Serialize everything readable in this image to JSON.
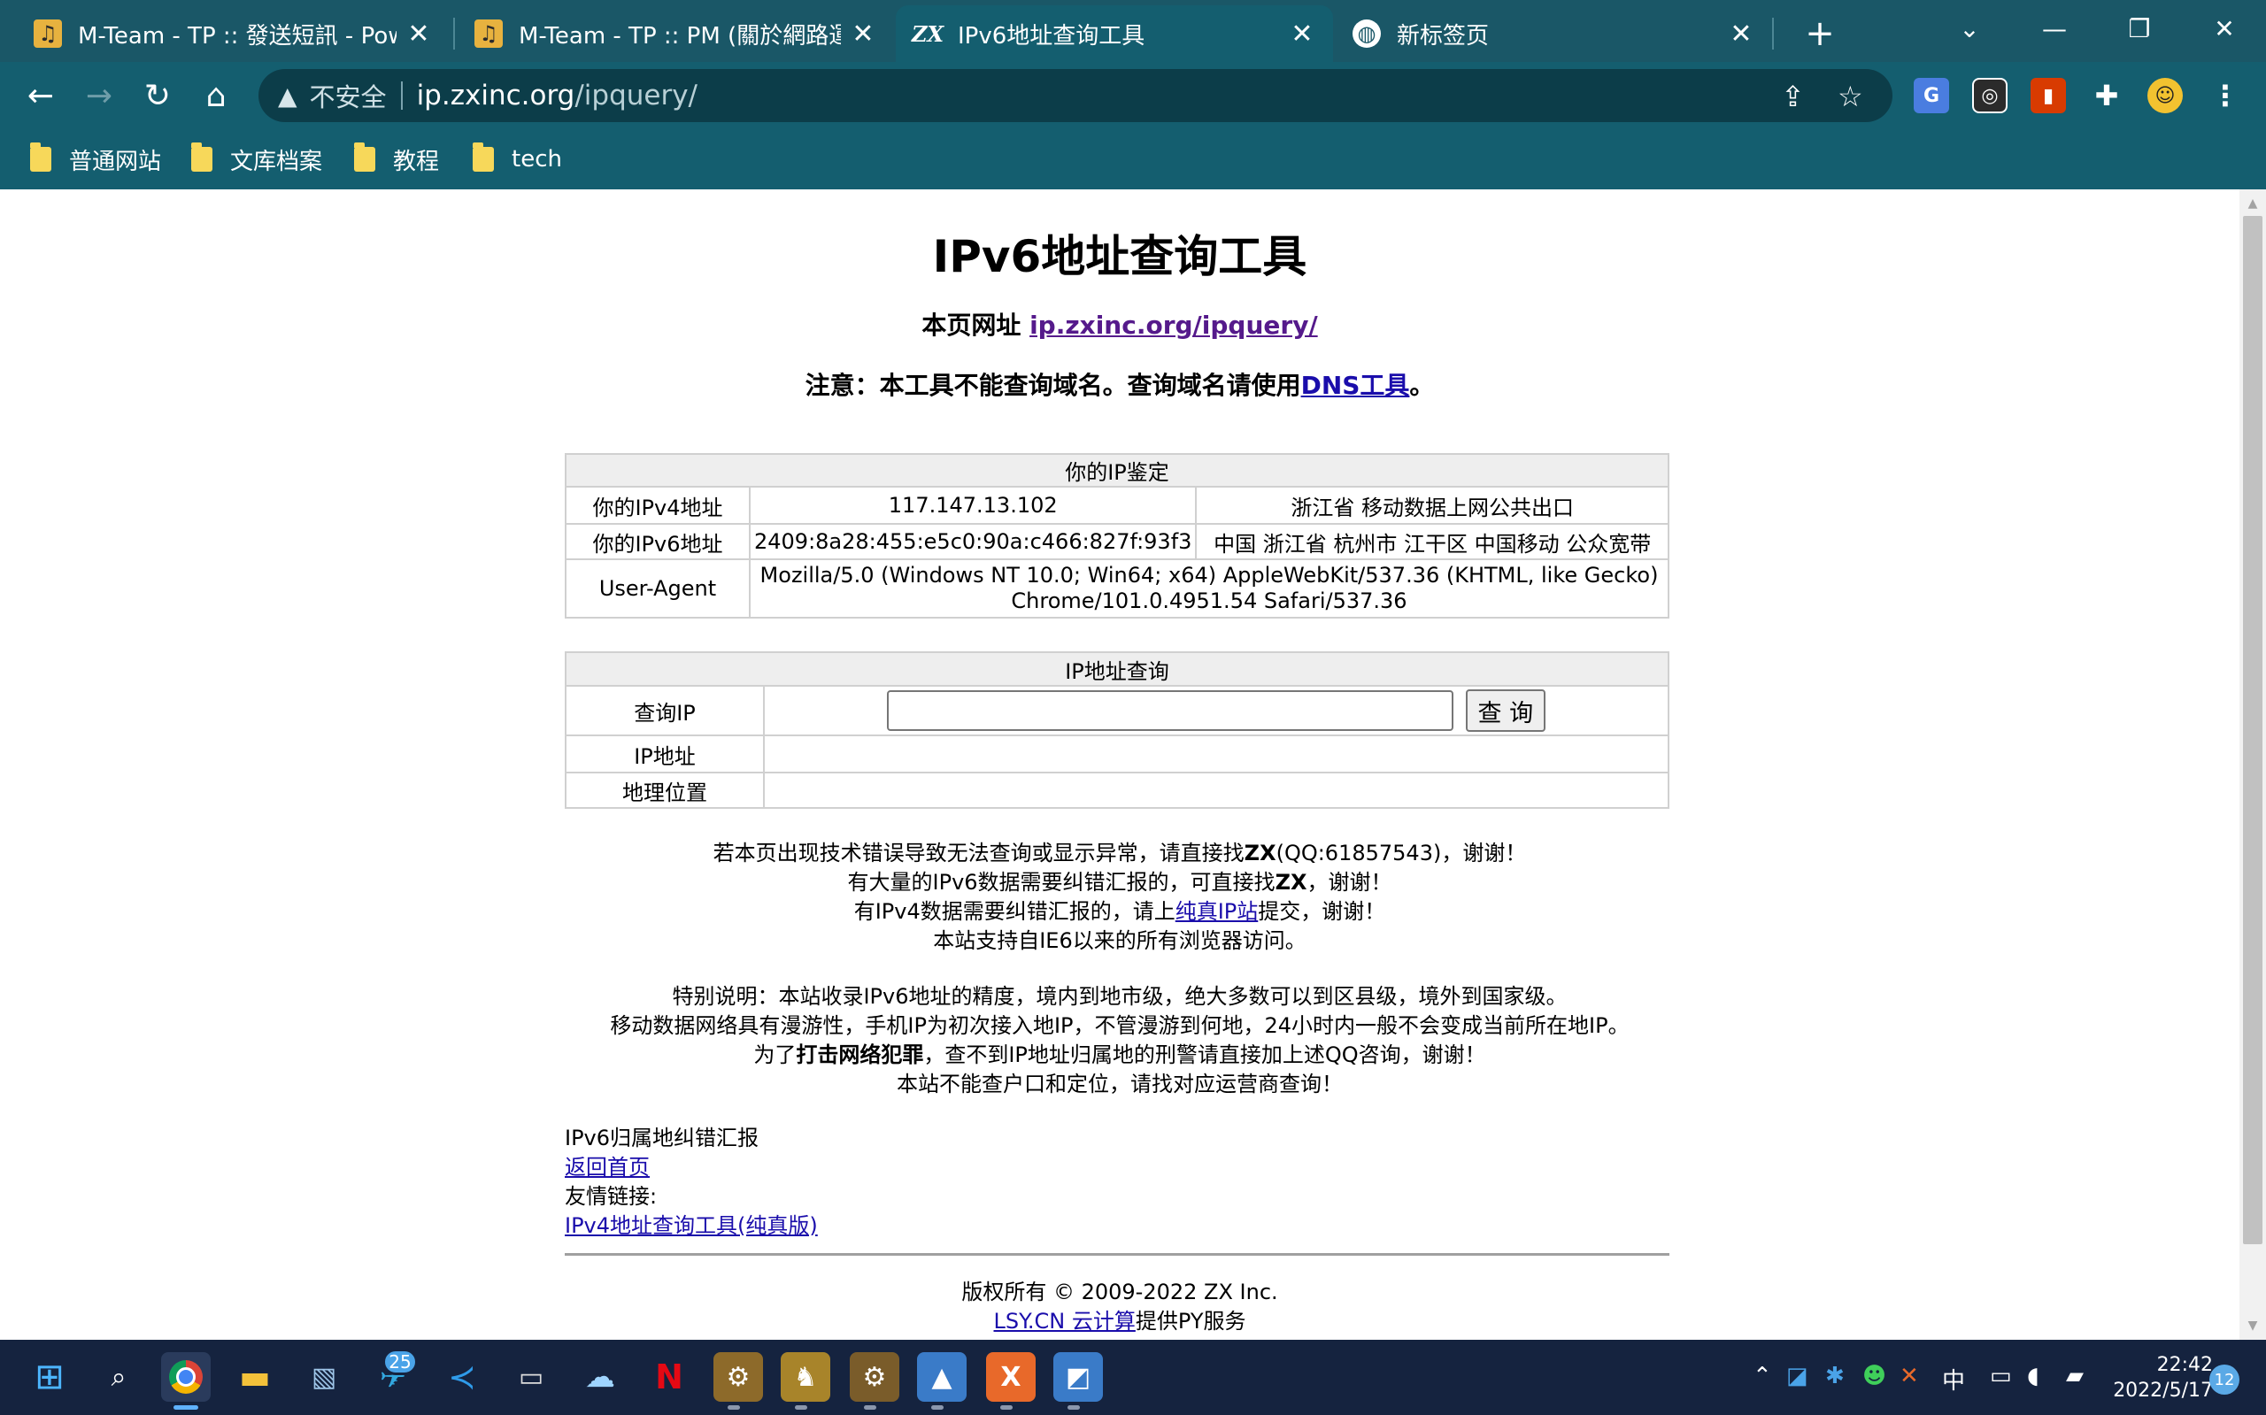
{
  "browser": {
    "tabs": [
      {
        "title": "M-Team - TP :: 發送短訊 - Power",
        "favicon": "mteam-icon"
      },
      {
        "title": "M-Team - TP :: PM (關於網路運",
        "favicon": "mteam-icon"
      },
      {
        "title": "IPv6地址查询工具",
        "favicon": "zx-icon",
        "active": true
      },
      {
        "title": "新标签页",
        "favicon": "globe-icon"
      }
    ],
    "omnibox": {
      "security_label": "不安全",
      "host": "ip.zxinc.org",
      "path": "/ipquery/"
    },
    "bookmarks": [
      {
        "label": "普通网站"
      },
      {
        "label": "文库档案"
      },
      {
        "label": "教程"
      },
      {
        "label": "tech"
      }
    ]
  },
  "page": {
    "title": "IPv6地址查询工具",
    "page_url_label": "本页网址 ",
    "page_url_link": "ip.zxinc.org/ipquery/",
    "notice_prefix": "注意：本工具不能查询域名。查询域名请使用",
    "notice_link": "DNS工具",
    "notice_suffix": "。",
    "identity_table": {
      "header": "你的IP鉴定",
      "rows": [
        {
          "label": "你的IPv4地址",
          "value": "117.147.13.102",
          "location": "浙江省 移动数据上网公共出口"
        },
        {
          "label": "你的IPv6地址",
          "value": "2409:8a28:455:e5c0:90a:c466:827f:93f3",
          "location": "中国 浙江省 杭州市 江干区 中国移动 公众宽带"
        }
      ],
      "ua_label": "User-Agent",
      "ua_line1": "Mozilla/5.0 (Windows NT 10.0; Win64; x64) AppleWebKit/537.36 (KHTML, like Gecko)",
      "ua_line2": "Chrome/101.0.4951.54 Safari/537.36"
    },
    "query_table": {
      "header": "IP地址查询",
      "query_label": "查询IP",
      "input_value": "",
      "button_label": "查 询",
      "ip_label": "IP地址",
      "ip_value": "",
      "geo_label": "地理位置",
      "geo_value": ""
    },
    "notes": {
      "n1_prefix": "若本页出现技术错误导致无法查询或显示异常，请直接找",
      "n1_bold": "ZX",
      "n1_suffix": "(QQ:61857543)，谢谢！",
      "n2_prefix": "有大量的IPv6数据需要纠错汇报的，可直接找",
      "n2_bold": "ZX",
      "n2_suffix": "，谢谢！",
      "n3_prefix": "有IPv4数据需要纠错汇报的，请上",
      "n3_link": "纯真IP站",
      "n3_suffix": "提交，谢谢！",
      "n4": "本站支持自IE6以来的所有浏览器访问。",
      "s1": "特别说明：本站收录IPv6地址的精度，境内到地市级，绝大多数可以到区县级，境外到国家级。",
      "s2": "移动数据网络具有漫游性，手机IP为初次接入地IP，不管漫游到何地，24小时内一般不会变成当前所在地IP。",
      "s3_prefix": "为了",
      "s3_bold": "打击网络犯罪",
      "s3_suffix": "，查不到IP地址归属地的刑警请直接加上述QQ咨询，谢谢！",
      "s4": "本站不能查户口和定位，请找对应运营商查询！"
    },
    "links": {
      "report": "IPv6归属地纠错汇报",
      "home": "返回首页",
      "friends_label": "友情链接:",
      "friend1": "IPv4地址查询工具(纯真版)"
    },
    "copyright": "版权所有 © 2009-2022 ZX Inc.",
    "hosting_link": "LSY.CN 云计算",
    "hosting_suffix": "提供PY服务"
  },
  "taskbar": {
    "telegram_badge": "25",
    "ime": "中",
    "time": "22:42",
    "date": "2022/5/17",
    "notifications": "12"
  }
}
